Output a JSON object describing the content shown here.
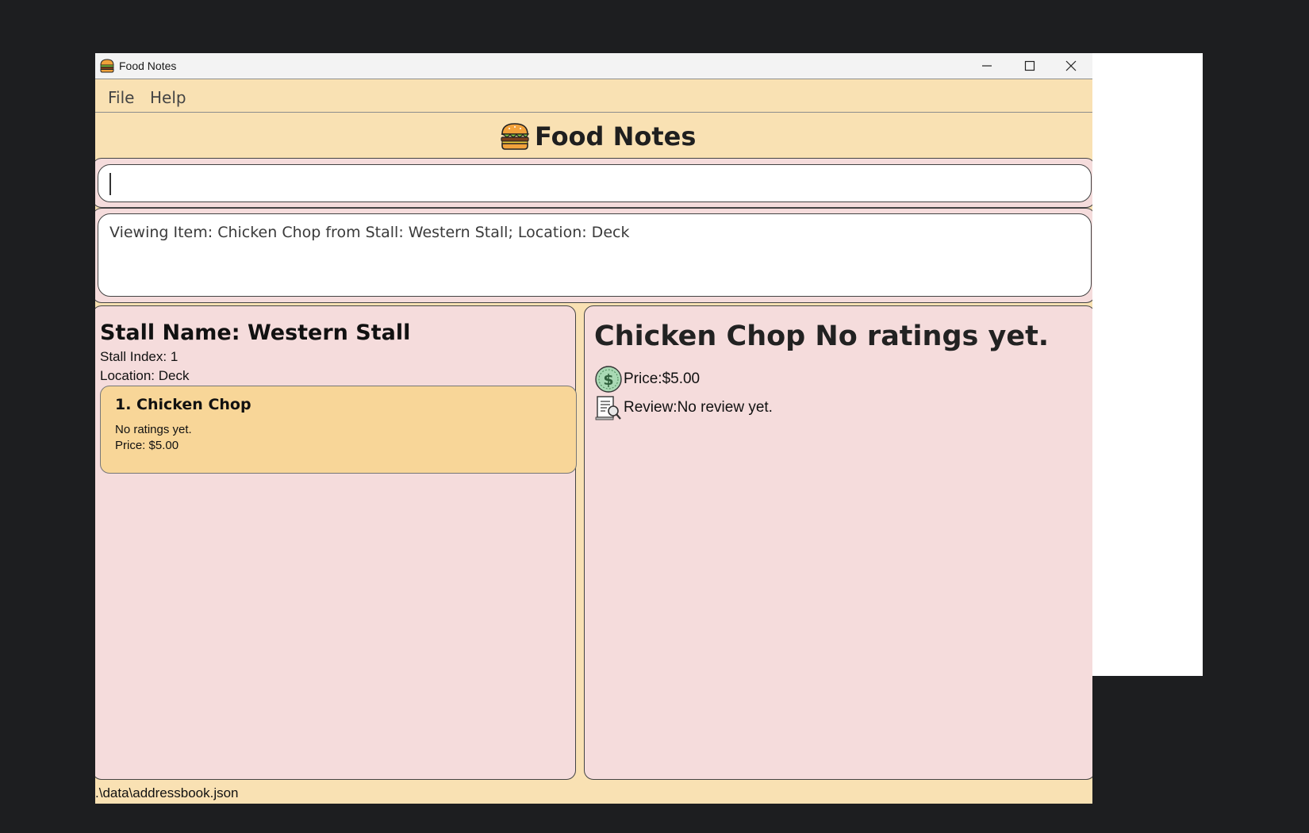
{
  "window": {
    "title": "Food Notes"
  },
  "menu": {
    "items": [
      "File",
      "Help"
    ]
  },
  "header": {
    "app_name": "Food Notes"
  },
  "command_box": {
    "value": ""
  },
  "result_display": {
    "text": "Viewing Item: Chicken Chop from Stall: Western Stall; Location: Deck"
  },
  "stall": {
    "name_label": "Stall Name: Western Stall",
    "index_label": "Stall Index: 1",
    "location_label": "Location: Deck",
    "items": [
      {
        "title": "1.  Chicken Chop",
        "rating": "No ratings yet.",
        "price": "Price: $5.00"
      }
    ]
  },
  "item_detail": {
    "heading": "Chicken Chop No ratings yet.",
    "price_label": "Price:$5.00",
    "review_label": "Review:No review yet.",
    "icons": {
      "price": "dollar-coin-icon",
      "review": "review-document-icon"
    }
  },
  "status_bar": {
    "path": ".\\data\\addressbook.json"
  },
  "colors": {
    "background": "#1d1e20",
    "window_bg": "#f9e1b3",
    "panel_bg": "#f5dcdc",
    "card_bg": "#f8d698",
    "titlebar_bg": "#f3f3f3"
  }
}
